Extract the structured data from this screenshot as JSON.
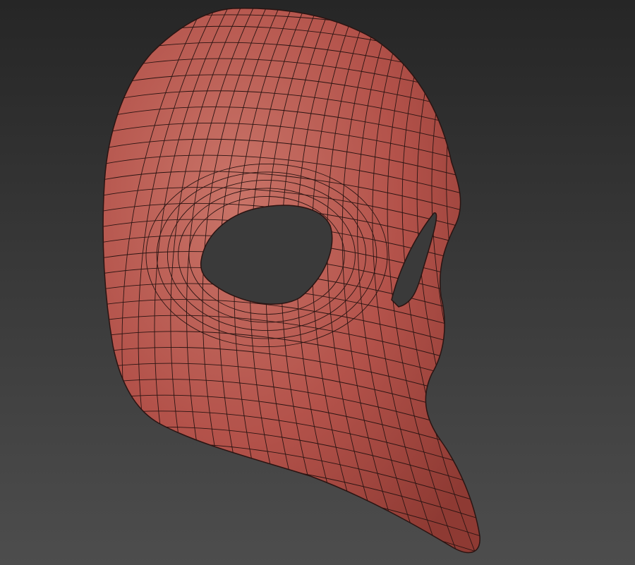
{
  "scene": {
    "subject": "mask-mesh",
    "colors": {
      "background_top": "#262626",
      "background_bottom": "#4d4d4d",
      "mask_base": "#b3524a",
      "mask_light": "#c97468",
      "mask_dark": "#8e3a33",
      "wire": "#2a1412",
      "eye_hole": "#3a3a3a"
    }
  }
}
